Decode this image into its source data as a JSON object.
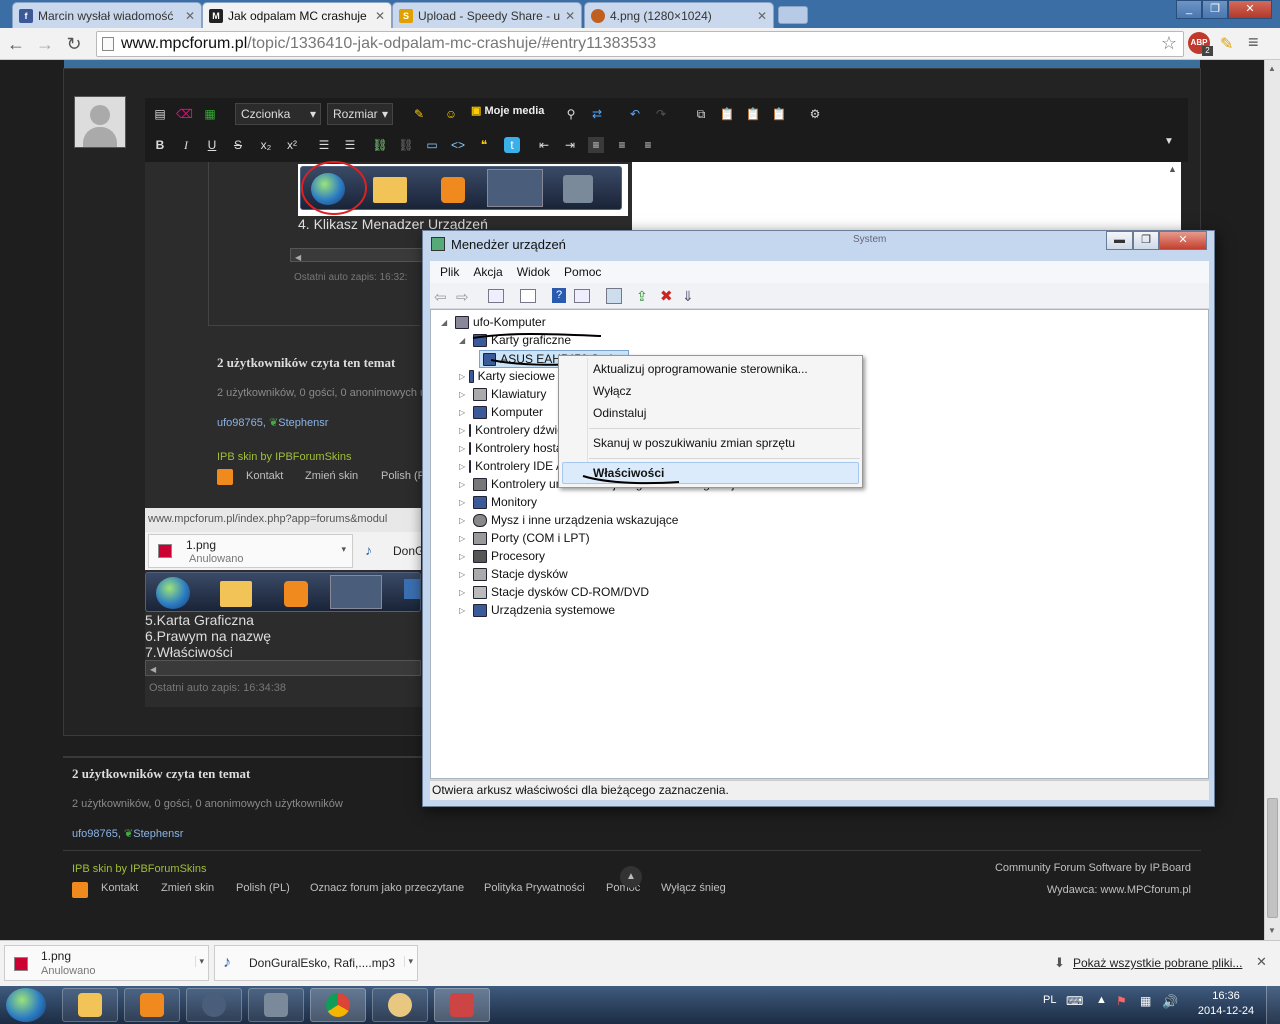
{
  "browser": {
    "tabs": [
      {
        "title": "Marcin wysłał wiadomość",
        "favicon": "facebook-icon",
        "color": "#3b5998"
      },
      {
        "title": "Jak odpalam MC crashuje",
        "favicon": "mpc-icon",
        "color": "#222222"
      },
      {
        "title": "Upload - Speedy Share - u",
        "favicon": "speedyshare-icon",
        "color": "#e0a000"
      },
      {
        "title": "4.png (1280×1024)",
        "favicon": "image-icon",
        "color": "#c06020"
      }
    ],
    "url_host": "www.mpcforum.pl",
    "url_path": "/topic/1336410-jak-odpalam-mc-crashuje/#entry11383533",
    "abp_badge": "ABP",
    "abp_count": "2"
  },
  "editor": {
    "font_select": "Czcionka",
    "size_select": "Rozmiar",
    "my_media": "Moje media",
    "inner_step4": "4. Klikasz Menadzer Urządzeń",
    "inner_autosave": "Ostatni auto zapis: 16:32:",
    "inner_users_title": "2 użytkowników czyta ten temat",
    "inner_users_line": "2 użytkowników, 0 gości, 0 anonimowych u",
    "inner_user1": "ufo98765",
    "inner_user2": "Stephensr",
    "inner_skin": "IPB skin by IPBForumSkins",
    "inner_links": [
      "Kontakt",
      "Zmień skin",
      "Polish (P"
    ],
    "inner_status_url": "www.mpcforum.pl/index.php?app=forums&modul",
    "inner_dl1_name": "1.png",
    "inner_dl1_state": "Anulowano",
    "inner_dl2_name": "DonG",
    "steps": [
      "5.Karta Graficzna",
      "6.Prawym na nazwę",
      "7.Właściwości"
    ],
    "autosave": "Ostatni auto zapis: 16:34:38"
  },
  "footer": {
    "users_title": "2 użytkowników czyta ten temat",
    "users_line": "2 użytkowników, 0 gości, 0 anonimowych użytkowników",
    "user1": "ufo98765",
    "user2": "Stephensr",
    "skin": "IPB skin by IPBForumSkins",
    "links": [
      "Kontakt",
      "Zmień skin",
      "Polish (PL)",
      "Oznacz forum jako przeczytane",
      "Polityka Prywatności",
      "Pomoc",
      "Wyłącz śnieg"
    ],
    "software": "Community Forum Software by IP.Board",
    "publisher": "Wydawca: www.MPCforum.pl"
  },
  "device_manager": {
    "title": "Menedżer urządzeń",
    "menu": [
      "Plik",
      "Akcja",
      "Widok",
      "Pomoc"
    ],
    "root": "ufo-Komputer",
    "expanded": "Karty graficzne",
    "selected_device": "ASUS EAH5450 Series",
    "categories": [
      "Karty sieciowe",
      "Klawiatury",
      "Komputer",
      "Kontrolery dźwięku, wideo i gier",
      "Kontrolery hosta magistrali IEEE 1394",
      "Kontrolery IDE ATA/ATAPI",
      "Kontrolery uniwersalnej magistrali szeregowej",
      "Monitory",
      "Mysz i inne urządzenia wskazujące",
      "Porty (COM i LPT)",
      "Procesory",
      "Stacje dysków",
      "Stacje dysków CD-ROM/DVD",
      "Urządzenia systemowe"
    ],
    "status": "Otwiera arkusz właściwości dla bieżącego zaznaczenia.",
    "behind_label": "System"
  },
  "context_menu": {
    "items": [
      "Aktualizuj oprogramowanie sterownika...",
      "Wyłącz",
      "Odinstaluj",
      "Skanuj w poszukiwaniu zmian sprzętu",
      "Właściwości"
    ]
  },
  "downloads": {
    "item1_name": "1.png",
    "item1_state": "Anulowano",
    "item2_name": "DonGuralEsko, Rafi,....mp3",
    "show_all": "Pokaż wszystkie pobrane pliki..."
  },
  "taskbar": {
    "lang": "PL",
    "time": "16:36",
    "date": "2014-12-24"
  }
}
